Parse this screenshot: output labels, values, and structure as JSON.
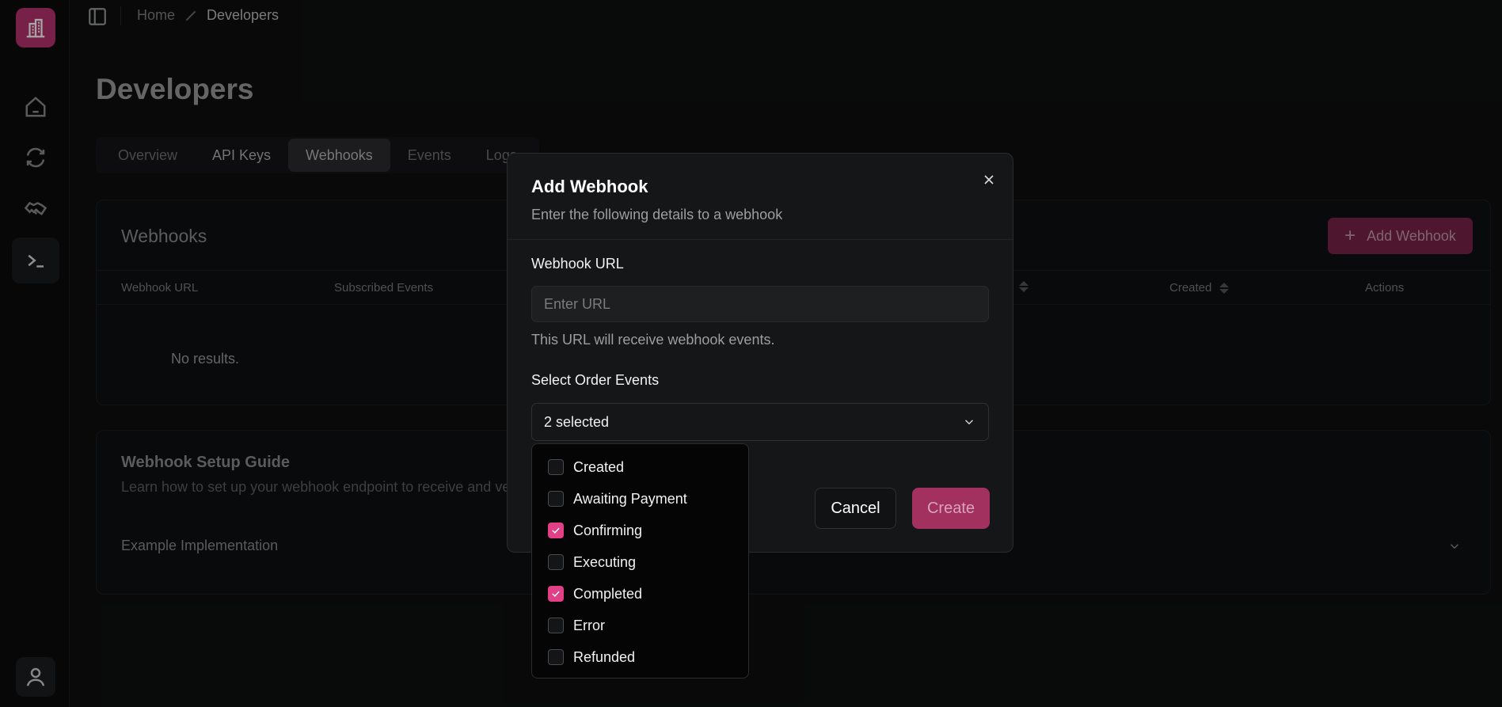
{
  "breadcrumb": {
    "home": "Home",
    "current": "Developers"
  },
  "page": {
    "title": "Developers"
  },
  "tabs": [
    {
      "label": "Overview"
    },
    {
      "label": "API Keys"
    },
    {
      "label": "Webhooks",
      "active": true
    },
    {
      "label": "Events"
    },
    {
      "label": "Logs"
    }
  ],
  "webhooks": {
    "title": "Webhooks",
    "add_button": "Add Webhook",
    "columns": {
      "url": "Webhook URL",
      "events": "Subscribed Events",
      "created": "Created",
      "actions": "Actions"
    },
    "empty": "No results."
  },
  "guide": {
    "title": "Webhook Setup Guide",
    "subtitle": "Learn how to set up your webhook endpoint to receive and verify",
    "example": "Example Implementation"
  },
  "modal": {
    "title": "Add Webhook",
    "subtitle": "Enter the following details to a webhook",
    "url_label": "Webhook URL",
    "url_placeholder": "Enter URL",
    "url_value": "",
    "url_help": "This URL will receive webhook events.",
    "events_label": "Select Order Events",
    "events_selected": "2 selected",
    "cancel": "Cancel",
    "create": "Create"
  },
  "events_options": [
    {
      "label": "Created",
      "checked": false
    },
    {
      "label": "Awaiting Payment",
      "checked": false
    },
    {
      "label": "Confirming",
      "checked": true
    },
    {
      "label": "Executing",
      "checked": false
    },
    {
      "label": "Completed",
      "checked": true
    },
    {
      "label": "Error",
      "checked": false
    },
    {
      "label": "Refunded",
      "checked": false
    }
  ],
  "colors": {
    "accent": "#e13f86",
    "brand": "#b8346f",
    "background": "#0e0f10"
  },
  "icons": {
    "logo": "building-icon",
    "nav": [
      "home-icon",
      "refresh-icon",
      "handshake-icon",
      "terminal-icon"
    ],
    "user": "user-icon"
  }
}
